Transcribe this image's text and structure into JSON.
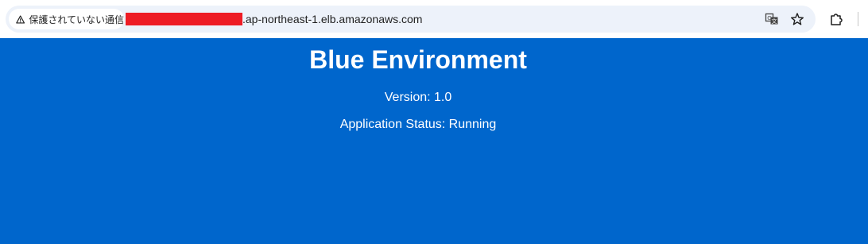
{
  "browser": {
    "security_label": "保護されていない通信",
    "url_suffix": ".ap-northeast-1.elb.amazonaws.com",
    "icons": {
      "security": "warning-triangle-icon",
      "translate": "translate-icon",
      "bookmark": "star-icon",
      "extensions": "puzzle-icon"
    },
    "redaction_color": "#ee1c25"
  },
  "page": {
    "background_color": "#0066cc",
    "title": "Blue Environment",
    "version": "Version: 1.0",
    "status": "Application Status: Running"
  }
}
